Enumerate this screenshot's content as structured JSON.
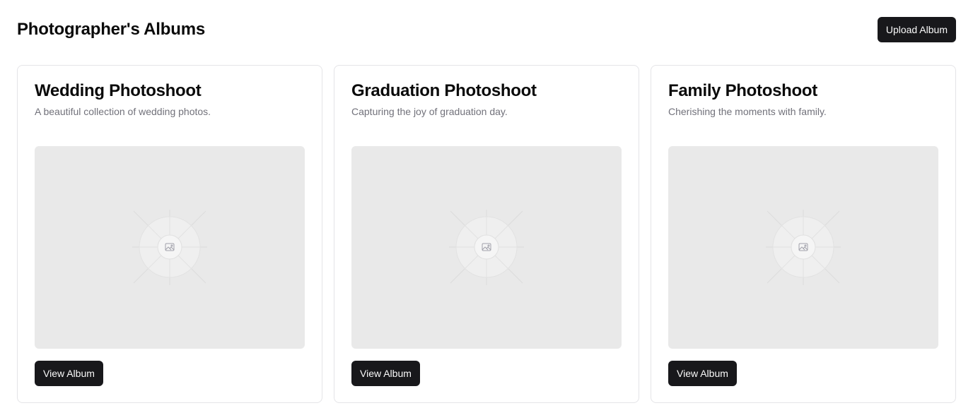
{
  "header": {
    "title": "Photographer's Albums",
    "upload_label": "Upload Album"
  },
  "albums": [
    {
      "title": "Wedding Photoshoot",
      "description": "A beautiful collection of wedding photos.",
      "image_icon": "image-placeholder-icon",
      "view_label": "View Album"
    },
    {
      "title": "Graduation Photoshoot",
      "description": "Capturing the joy of graduation day.",
      "image_icon": "image-placeholder-icon",
      "view_label": "View Album"
    },
    {
      "title": "Family Photoshoot",
      "description": "Cherishing the moments with family.",
      "image_icon": "image-placeholder-icon",
      "view_label": "View Album"
    }
  ],
  "colors": {
    "button_bg": "#18181b",
    "button_text": "#fafafa",
    "card_border": "#e4e4e7",
    "muted_text": "#71717a",
    "placeholder_bg": "#e9e9e9"
  }
}
